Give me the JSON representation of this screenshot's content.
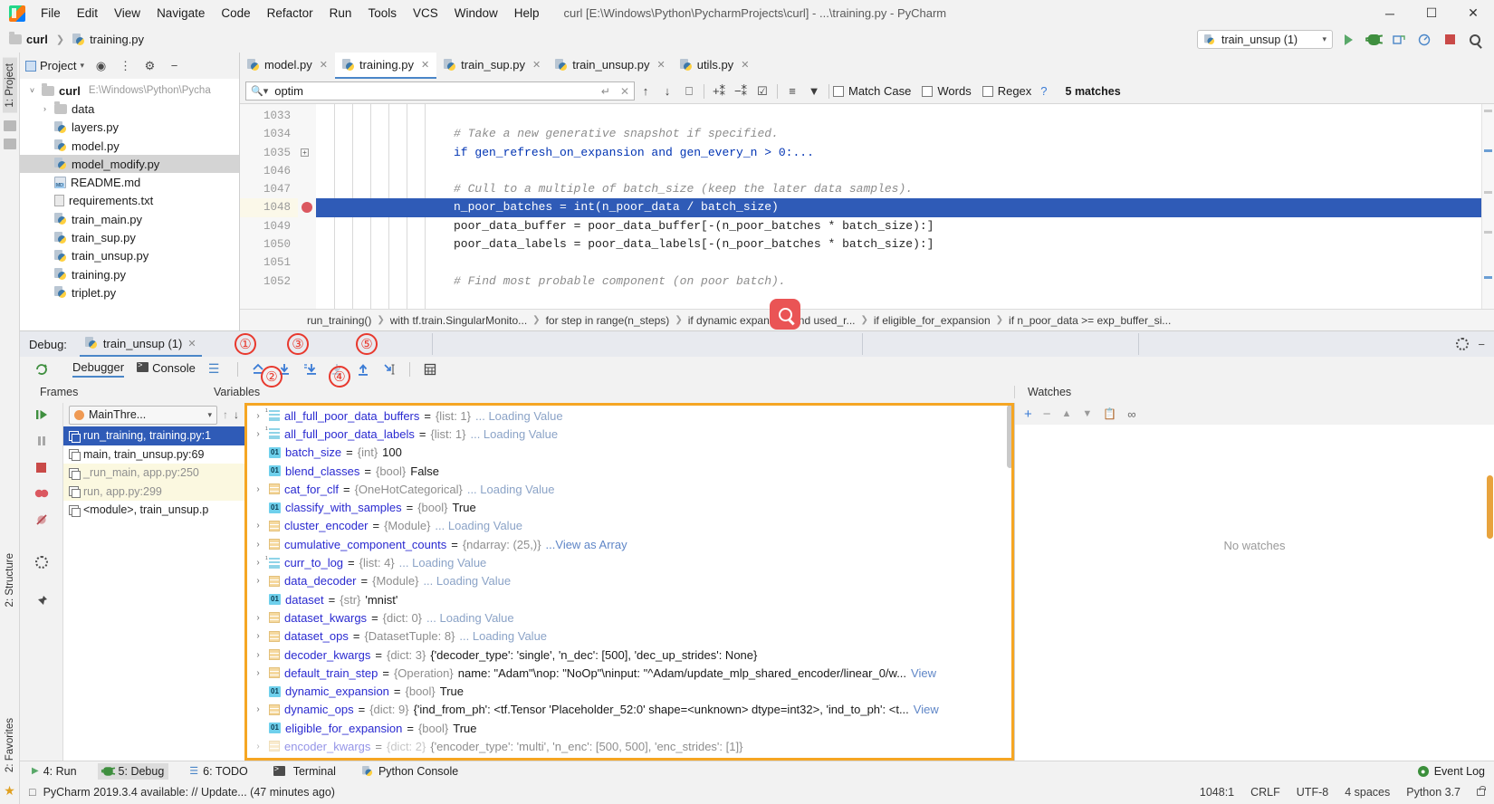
{
  "titlebar": {
    "menus": [
      "File",
      "Edit",
      "View",
      "Navigate",
      "Code",
      "Refactor",
      "Run",
      "Tools",
      "VCS",
      "Window",
      "Help"
    ],
    "window_title": "curl [E:\\Windows\\Python\\PycharmProjects\\curl] - ...\\training.py - PyCharm",
    "minimize": "─",
    "maximize": "☐",
    "close": "✕"
  },
  "navbar": {
    "breadcrumb": [
      "curl",
      "training.py"
    ],
    "run_config": "train_unsup (1)",
    "caret": "▾"
  },
  "project": {
    "title": "Project",
    "title_caret": "▾",
    "root": "curl",
    "root_path": "E:\\Windows\\Python\\Pycha",
    "items": [
      {
        "label": "data",
        "type": "folder",
        "indent": 2,
        "arrow": "›",
        "selected": false
      },
      {
        "label": "layers.py",
        "type": "py",
        "indent": 2,
        "arrow": "",
        "selected": false
      },
      {
        "label": "model.py",
        "type": "py",
        "indent": 2,
        "arrow": "",
        "selected": false
      },
      {
        "label": "model_modify.py",
        "type": "py",
        "indent": 2,
        "arrow": "",
        "selected": true
      },
      {
        "label": "README.md",
        "type": "md",
        "indent": 2,
        "arrow": "",
        "selected": false
      },
      {
        "label": "requirements.txt",
        "type": "txt",
        "indent": 2,
        "arrow": "",
        "selected": false
      },
      {
        "label": "train_main.py",
        "type": "py",
        "indent": 2,
        "arrow": "",
        "selected": false
      },
      {
        "label": "train_sup.py",
        "type": "py",
        "indent": 2,
        "arrow": "",
        "selected": false
      },
      {
        "label": "train_unsup.py",
        "type": "py",
        "indent": 2,
        "arrow": "",
        "selected": false
      },
      {
        "label": "training.py",
        "type": "py",
        "indent": 2,
        "arrow": "",
        "selected": false
      },
      {
        "label": "triplet.py",
        "type": "py",
        "indent": 2,
        "arrow": "",
        "selected": false
      }
    ]
  },
  "editor": {
    "tabs": [
      {
        "label": "model.py",
        "active": false
      },
      {
        "label": "training.py",
        "active": true
      },
      {
        "label": "train_sup.py",
        "active": false
      },
      {
        "label": "train_unsup.py",
        "active": false
      },
      {
        "label": "utils.py",
        "active": false
      }
    ],
    "find": {
      "value": "optim",
      "placeholder": "Search",
      "match_case": "Match Case",
      "words": "Words",
      "regex": "Regex",
      "help": "?",
      "matches": "5 matches"
    },
    "lines": [
      {
        "num": "1033",
        "text": "",
        "kind": "blank"
      },
      {
        "num": "1034",
        "text": "# Take a new generative snapshot if specified.",
        "kind": "comment"
      },
      {
        "num": "1035",
        "text": "if gen_refresh_on_expansion and gen_every_n > 0:...",
        "kind": "code-if"
      },
      {
        "num": "1046",
        "text": "",
        "kind": "blank"
      },
      {
        "num": "1047",
        "text": "# Cull to a multiple of batch_size (keep the later data samples).",
        "kind": "comment"
      },
      {
        "num": "1048",
        "text": "n_poor_batches = int(n_poor_data / batch_size)",
        "kind": "selected"
      },
      {
        "num": "1049",
        "text": "poor_data_buffer = poor_data_buffer[-(n_poor_batches * batch_size):]",
        "kind": "code"
      },
      {
        "num": "1050",
        "text": "poor_data_labels = poor_data_labels[-(n_poor_batches * batch_size):]",
        "kind": "code"
      },
      {
        "num": "1051",
        "text": "",
        "kind": "blank"
      },
      {
        "num": "1052",
        "text": "# Find most probable component (on poor batch).",
        "kind": "comment"
      }
    ],
    "breadcrumb": [
      "run_training()",
      "with tf.train.SingularMonito...",
      "for step in range(n_steps)",
      "if dynamic expansion and used_r...",
      "if eligible_for_expansion",
      "if n_poor_data >= exp_buffer_si..."
    ]
  },
  "debug": {
    "label": "Debug:",
    "session": "train_unsup (1)",
    "subtabs": [
      {
        "label": "Debugger",
        "active": true
      },
      {
        "label": "Console",
        "active": false
      }
    ],
    "columns": {
      "frames": "Frames",
      "variables": "Variables",
      "watches": "Watches"
    },
    "thread": "MainThre...",
    "frames": [
      {
        "label": "run_training, training.py:1",
        "state": "selected"
      },
      {
        "label": "main, train_unsup.py:69",
        "state": "normal"
      },
      {
        "label": "_run_main, app.py:250",
        "state": "lib"
      },
      {
        "label": "run, app.py:299",
        "state": "lib"
      },
      {
        "label": "<module>, train_unsup.p",
        "state": "normal"
      }
    ],
    "variables": [
      {
        "arrow": "›",
        "icon": "list",
        "name": "all_full_poor_data_buffers",
        "type": "{list: 1}",
        "value": "",
        "suffix": "... Loading Value"
      },
      {
        "arrow": "›",
        "icon": "list",
        "name": "all_full_poor_data_labels",
        "type": "{list: 1}",
        "value": "",
        "suffix": "... Loading Value"
      },
      {
        "arrow": "",
        "icon": "prim",
        "name": "batch_size",
        "type": "{int}",
        "value": "100",
        "suffix": ""
      },
      {
        "arrow": "",
        "icon": "prim",
        "name": "blend_classes",
        "type": "{bool}",
        "value": "False",
        "suffix": ""
      },
      {
        "arrow": "›",
        "icon": "obj",
        "name": "cat_for_clf",
        "type": "{OneHotCategorical}",
        "value": "",
        "suffix": "... Loading Value"
      },
      {
        "arrow": "",
        "icon": "prim",
        "name": "classify_with_samples",
        "type": "{bool}",
        "value": "True",
        "suffix": ""
      },
      {
        "arrow": "›",
        "icon": "obj",
        "name": "cluster_encoder",
        "type": "{Module}",
        "value": "",
        "suffix": "... Loading Value"
      },
      {
        "arrow": "›",
        "icon": "obj",
        "name": "cumulative_component_counts",
        "type": "{ndarray: (25,)}",
        "value": "",
        "suffix": "...View as Array"
      },
      {
        "arrow": "›",
        "icon": "list",
        "name": "curr_to_log",
        "type": "{list: 4}",
        "value": "",
        "suffix": "... Loading Value"
      },
      {
        "arrow": "›",
        "icon": "obj",
        "name": "data_decoder",
        "type": "{Module}",
        "value": "",
        "suffix": "... Loading Value"
      },
      {
        "arrow": "",
        "icon": "prim",
        "name": "dataset",
        "type": "{str}",
        "value": "'mnist'",
        "suffix": ""
      },
      {
        "arrow": "›",
        "icon": "obj",
        "name": "dataset_kwargs",
        "type": "{dict: 0}",
        "value": "",
        "suffix": "... Loading Value"
      },
      {
        "arrow": "›",
        "icon": "obj",
        "name": "dataset_ops",
        "type": "{DatasetTuple: 8}",
        "value": "",
        "suffix": "... Loading Value"
      },
      {
        "arrow": "›",
        "icon": "obj",
        "name": "decoder_kwargs",
        "type": "{dict: 3}",
        "value": "{'decoder_type': 'single', 'n_dec': [500], 'dec_up_strides': None}",
        "suffix": ""
      },
      {
        "arrow": "›",
        "icon": "obj",
        "name": "default_train_step",
        "type": "{Operation}",
        "value": "name: \"Adam\"\\nop: \"NoOp\"\\ninput: \"^Adam/update_mlp_shared_encoder/linear_0/w...",
        "suffix": "View"
      },
      {
        "arrow": "",
        "icon": "prim",
        "name": "dynamic_expansion",
        "type": "{bool}",
        "value": "True",
        "suffix": ""
      },
      {
        "arrow": "›",
        "icon": "obj",
        "name": "dynamic_ops",
        "type": "{dict: 9}",
        "value": "{'ind_from_ph': <tf.Tensor 'Placeholder_52:0' shape=<unknown> dtype=int32>, 'ind_to_ph': <t...",
        "suffix": "View"
      },
      {
        "arrow": "",
        "icon": "prim",
        "name": "eligible_for_expansion",
        "type": "{bool}",
        "value": "True",
        "suffix": ""
      },
      {
        "arrow": "›",
        "icon": "obj",
        "name": "encoder_kwargs",
        "type": "{dict: 2}",
        "value": "{'encoder_type': 'multi', 'n_enc': [500, 500], 'enc_strides': [1]}",
        "suffix": ""
      }
    ],
    "no_watches": "No watches",
    "annotations": [
      "①",
      "②",
      "③",
      "④",
      "⑤"
    ]
  },
  "toolwindows": [
    {
      "label": "4: Run",
      "active": false
    },
    {
      "label": "5: Debug",
      "active": true
    },
    {
      "label": "6: TODO",
      "active": false
    },
    {
      "label": "Terminal",
      "active": false
    },
    {
      "label": "Python Console",
      "active": false
    }
  ],
  "event_log": "Event Log",
  "statusbar": {
    "message": "PyCharm 2019.3.4 available: // Update... (47 minutes ago)",
    "position": "1048:1",
    "line_sep": "CRLF",
    "encoding": "UTF-8",
    "indent": "4 spaces",
    "interpreter": "Python 3.7"
  },
  "leftstripe": {
    "tabs": [
      "1: Project",
      "2: Structure",
      "2: Favorites"
    ]
  },
  "colors": {
    "accent_blue": "#2f5bb7",
    "annotation_red": "#e8392e",
    "highlight_orange": "#f5a623",
    "breakpoint_red": "#db5860",
    "green_run": "#59a869"
  }
}
